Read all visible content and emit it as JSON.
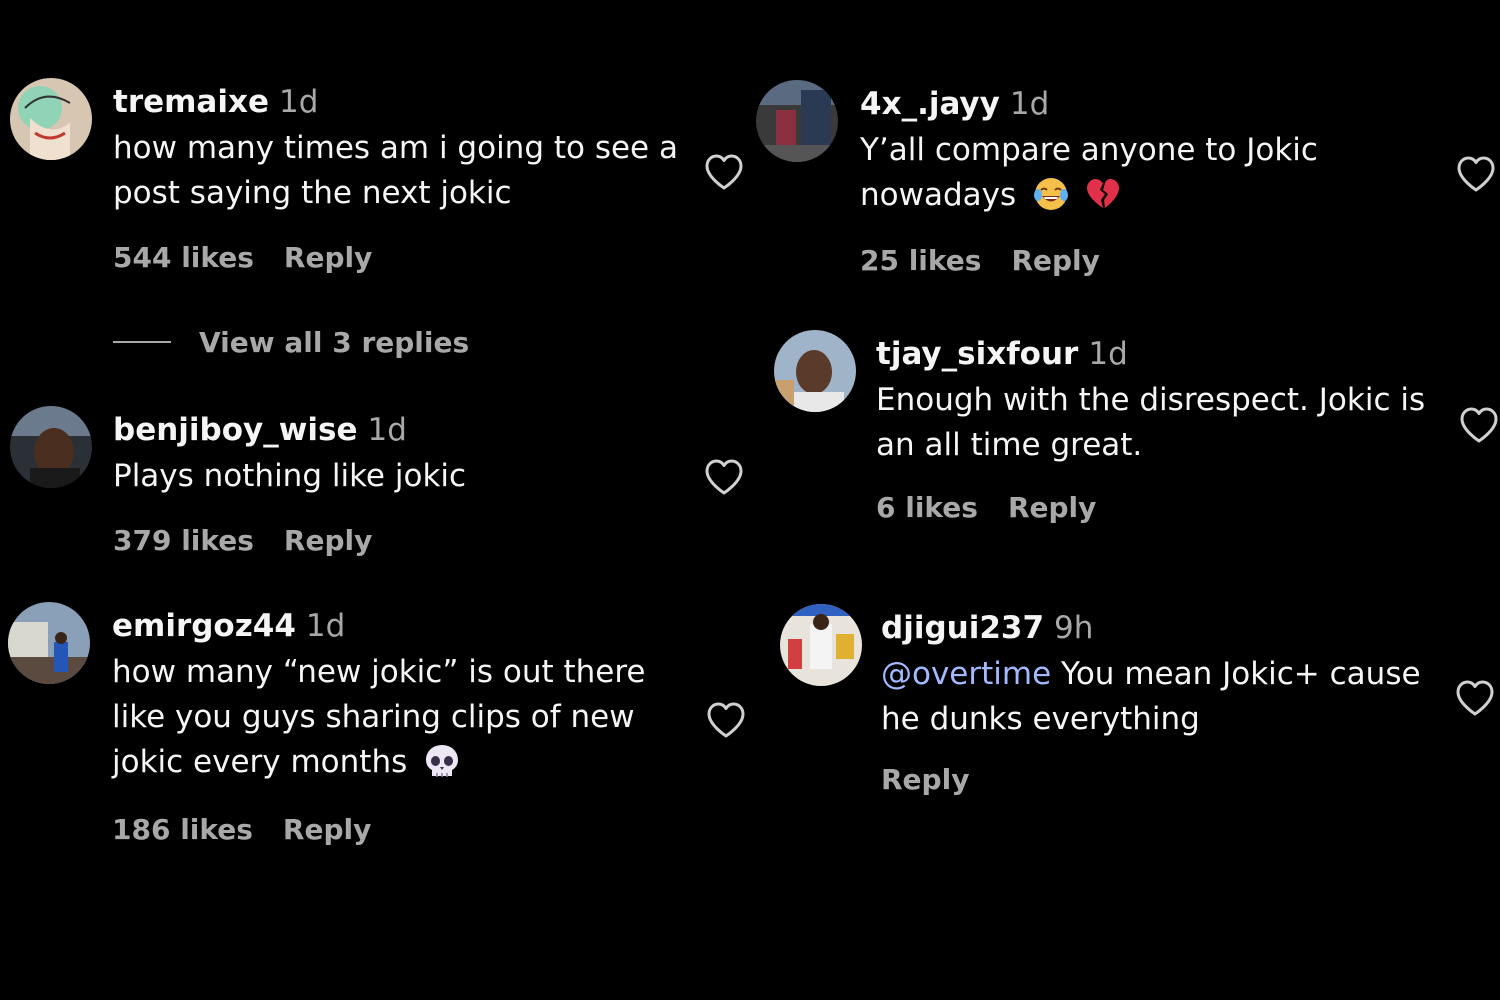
{
  "comments": [
    {
      "username": "tremaixe",
      "time": "1d",
      "text": "how many times am i going to see a post saying the next jokic",
      "likes": "544 likes",
      "reply": "Reply",
      "view_replies": "View all 3 replies"
    },
    {
      "username": "benjiboy_wise",
      "time": "1d",
      "text": "Plays nothing like jokic",
      "likes": "379 likes",
      "reply": "Reply"
    },
    {
      "username": "emirgoz44",
      "time": "1d",
      "text": "how many “new jokic” is out there like you guys sharing clips of new jokic every months",
      "likes": "186 likes",
      "reply": "Reply",
      "emojis": [
        "skull-emoji"
      ]
    },
    {
      "username": "4x_.jayy",
      "time": "1d",
      "text": "Y’all compare anyone to Jokic nowadays",
      "likes": "25 likes",
      "reply": "Reply",
      "emojis": [
        "tears-of-joy-emoji",
        "broken-heart-emoji"
      ]
    },
    {
      "username": "tjay_sixfour",
      "time": "1d",
      "text": "Enough with the disrespect. Jokic is an all time great.",
      "likes": "6 likes",
      "reply": "Reply"
    },
    {
      "username": "djigui237",
      "time": "9h",
      "mention": "@overtime",
      "text": " You mean Jokic+ cause he dunks everything",
      "reply": "Reply"
    }
  ],
  "icons": {
    "like": "heart-outline-icon"
  },
  "colors": {
    "background": "#000000",
    "primary_text": "#f5f5f5",
    "secondary_text": "#a8a8a8",
    "mention": "#a3b9ff"
  }
}
